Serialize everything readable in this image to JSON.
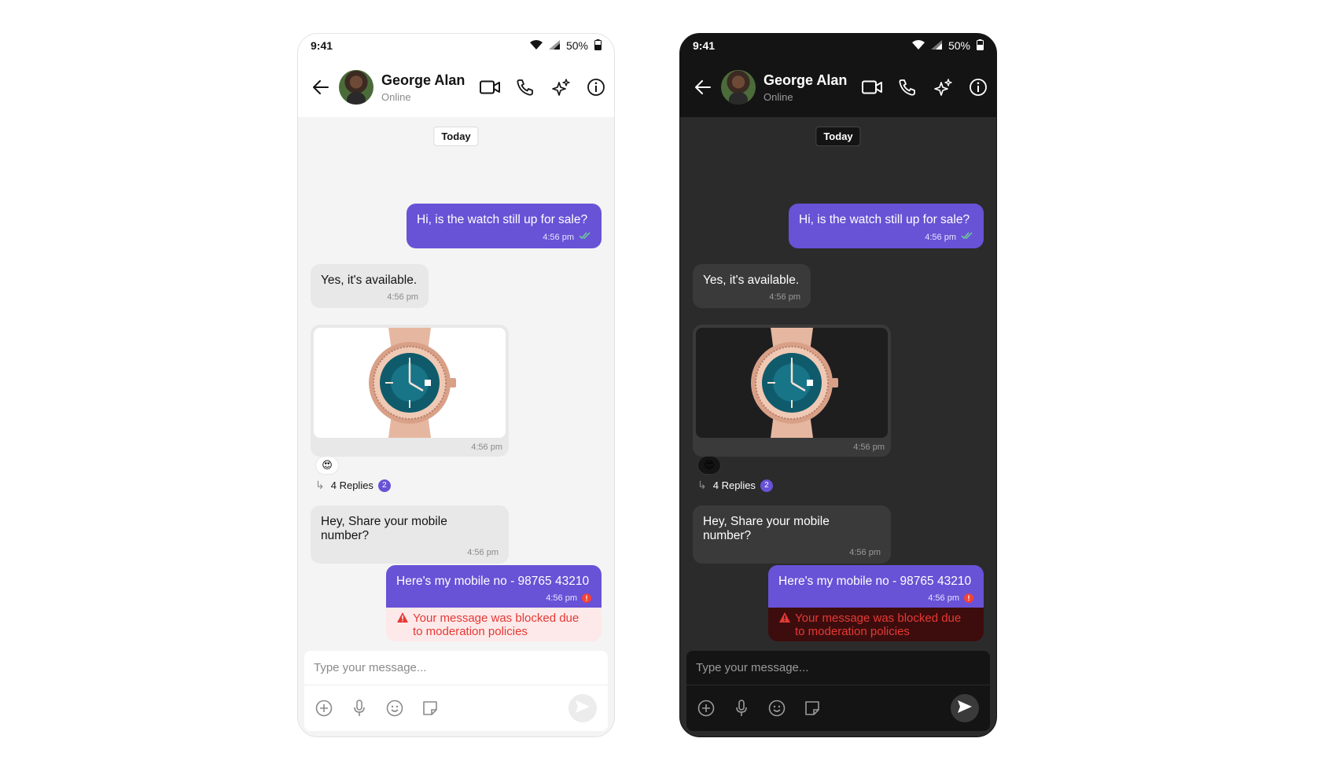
{
  "colors": {
    "accent": "#6852d6",
    "error": "#e53935",
    "read_receipt": "#6fcf97"
  },
  "status": {
    "time": "9:41",
    "battery": "50%"
  },
  "header": {
    "name": "George Alan",
    "presence": "Online"
  },
  "date_chip": "Today",
  "messages": {
    "m1": {
      "text": "Hi, is the watch still up for sale?",
      "time": "4:56 pm"
    },
    "m2": {
      "text": "Yes, it's available.",
      "time": "4:56 pm"
    },
    "m3": {
      "time": "4:56 pm",
      "reaction": "😍",
      "replies_label": "4 Replies",
      "replies_count": "2"
    },
    "m4": {
      "text": "Hey, Share your mobile number?",
      "time": "4:56 pm"
    },
    "m5": {
      "text": "Here's my mobile no - 98765 43210",
      "time": "4:56 pm",
      "blocked_notice": "Your message was blocked due to moderation policies"
    }
  },
  "composer": {
    "placeholder": "Type your message..."
  },
  "icons": [
    "back-arrow-icon",
    "video-call-icon",
    "voice-call-icon",
    "ai-sparkle-icon",
    "info-icon",
    "add-icon",
    "microphone-icon",
    "emoji-icon",
    "sticker-icon",
    "send-icon",
    "wifi-icon",
    "signal-icon",
    "battery-icon"
  ]
}
